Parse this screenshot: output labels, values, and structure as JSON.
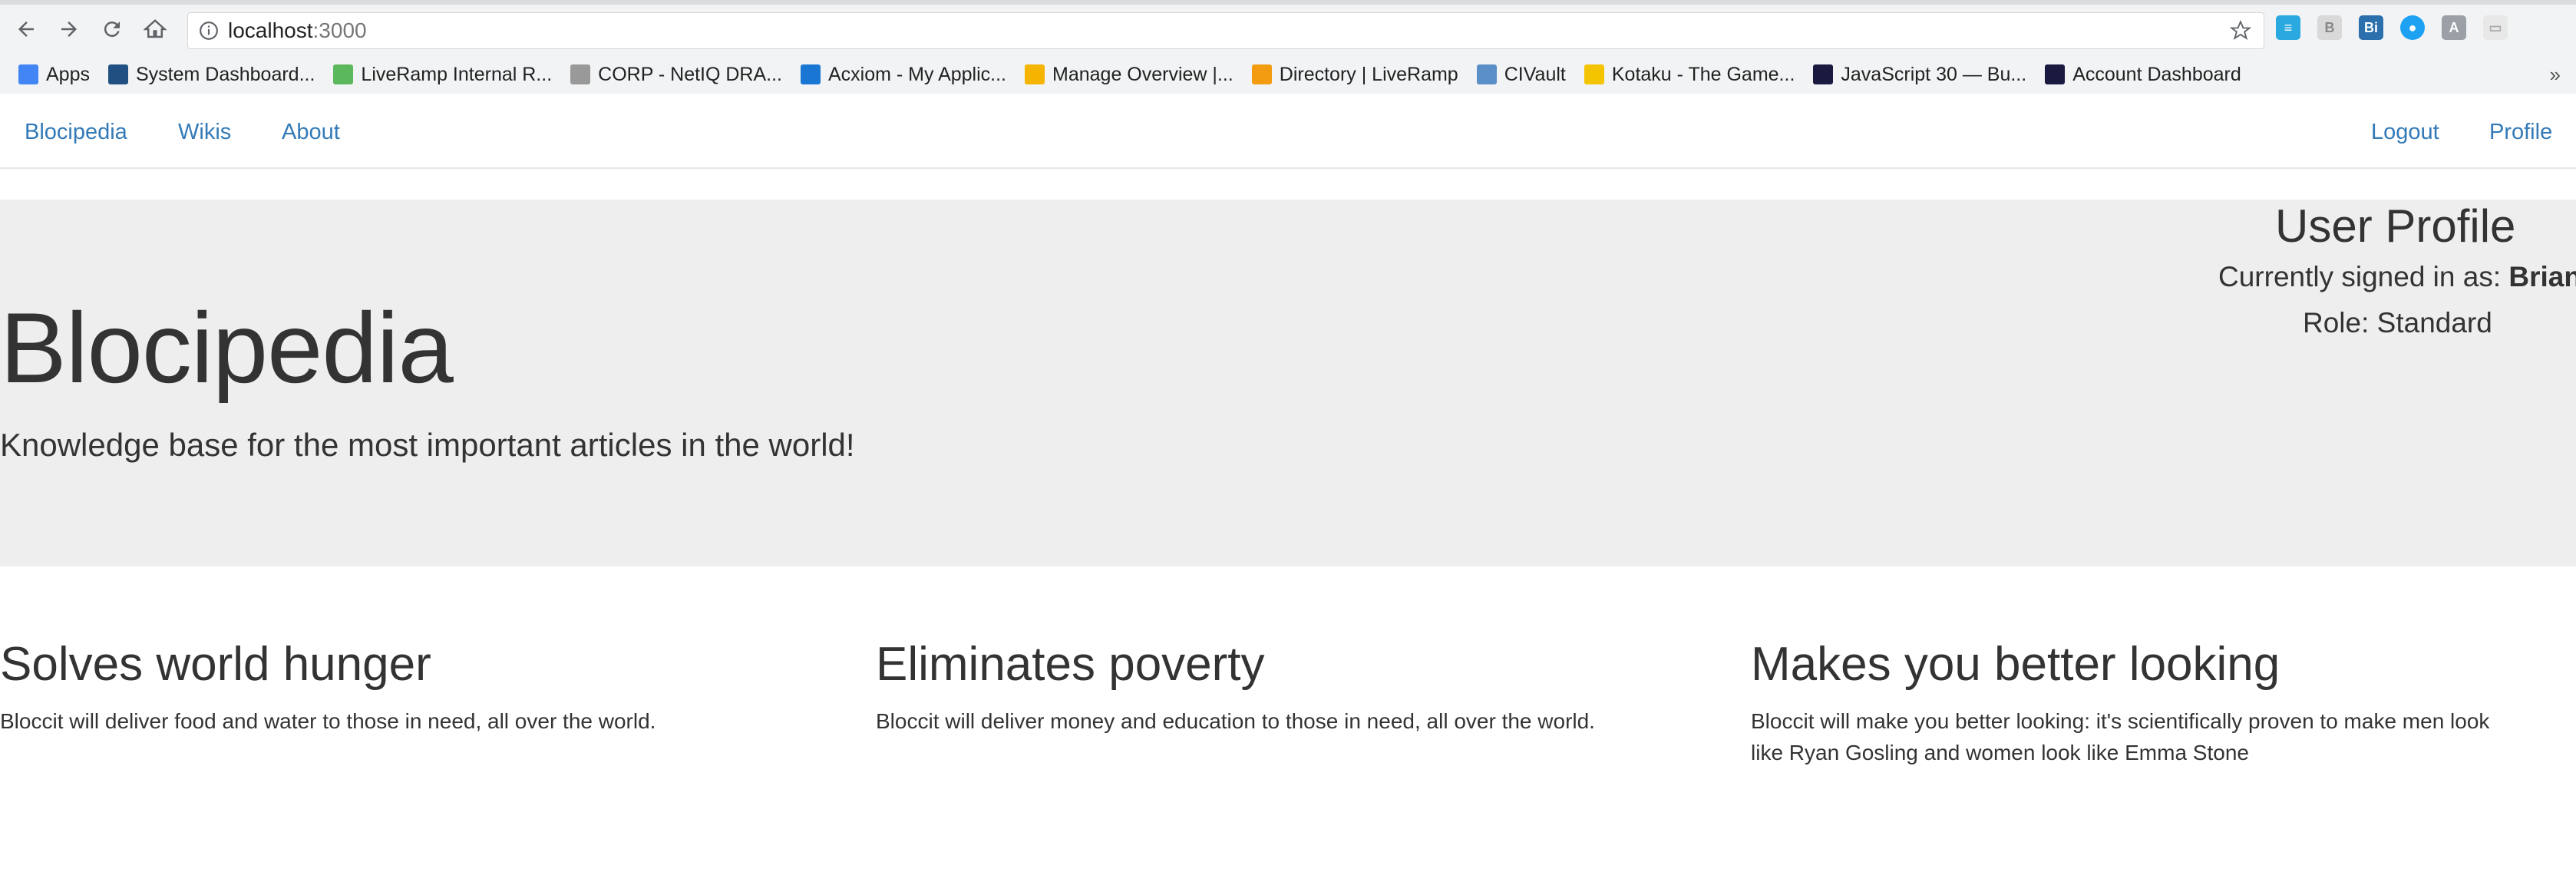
{
  "browser": {
    "url_host": "localhost",
    "url_port": ":3000",
    "bookmarks": [
      {
        "label": "Apps",
        "icon": "apps-grid-icon",
        "color": "#4285f4"
      },
      {
        "label": "System Dashboard...",
        "icon": "jira-icon",
        "color": "#205081"
      },
      {
        "label": "LiveRamp Internal R...",
        "icon": "chart-icon",
        "color": "#5cb85c"
      },
      {
        "label": "CORP - NetIQ DRA...",
        "icon": "document-icon",
        "color": "#999999"
      },
      {
        "label": "Acxiom - My Applic...",
        "icon": "circle-icon",
        "color": "#1976d2"
      },
      {
        "label": "Manage Overview |...",
        "icon": "es-icon",
        "color": "#f5b400"
      },
      {
        "label": "Directory | LiveRamp",
        "icon": "grid-icon",
        "color": "#f39c12"
      },
      {
        "label": "CIVault",
        "icon": "globe-icon",
        "color": "#5b8fc7"
      },
      {
        "label": "Kotaku - The Game...",
        "icon": "kotaku-icon",
        "color": "#f5c400"
      },
      {
        "label": "JavaScript 30 — Bu...",
        "icon": "js30-icon",
        "color": "#1a1a40"
      },
      {
        "label": "Account Dashboard",
        "icon": "js30-icon",
        "color": "#1a1a40"
      }
    ],
    "more_label": "»"
  },
  "navbar": {
    "brand": "Blocipedia",
    "wikis": "Wikis",
    "about": "About",
    "logout": "Logout",
    "profile": "Profile"
  },
  "hero": {
    "title": "Blocipedia",
    "subtitle": "Knowledge base for the most important articles in the world!"
  },
  "profile_box": {
    "title": "User Profile",
    "signed_in_prefix": "Currently signed in as: ",
    "signed_in_user": "Brian",
    "role": "Role: Standard"
  },
  "features": [
    {
      "heading": "Solves world hunger",
      "body": "Bloccit will deliver food and water to those in need, all over the world."
    },
    {
      "heading": "Eliminates poverty",
      "body": "Bloccit will deliver money and education to those in need, all over the world."
    },
    {
      "heading": "Makes you better looking",
      "body": "Bloccit will make you better looking: it's scientifically proven to make men look like Ryan Gosling and women look like Emma Stone"
    }
  ],
  "colors": {
    "link": "#337ab7",
    "jumbotron": "#eeeeee",
    "text": "#333333"
  }
}
